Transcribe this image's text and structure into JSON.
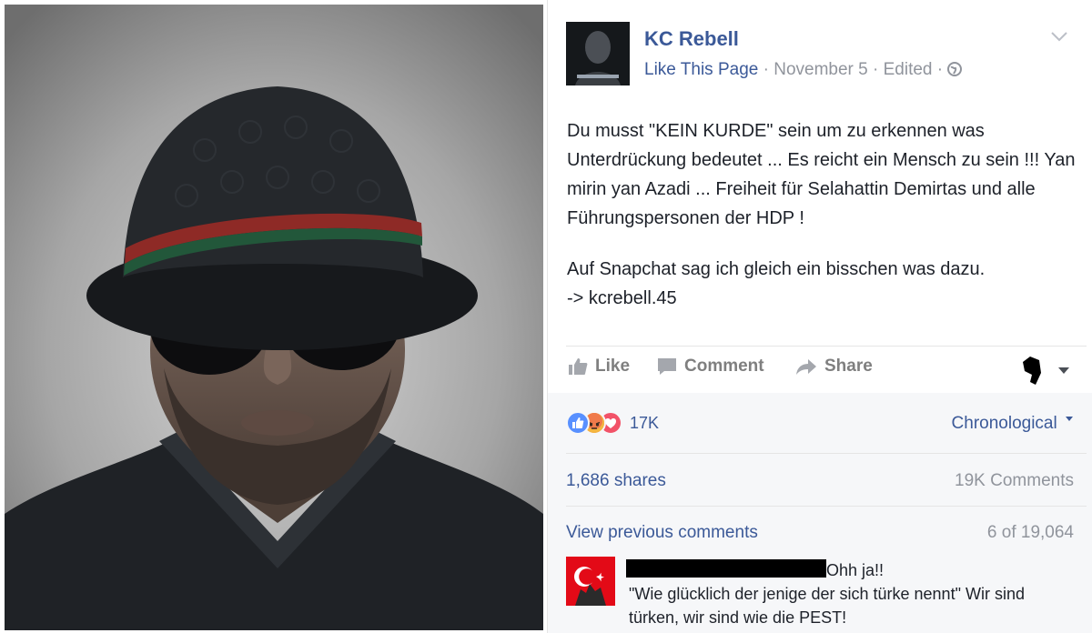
{
  "post": {
    "page_name": "KC Rebell",
    "like_page": "Like This Page",
    "date": "November 5",
    "edited": "Edited",
    "separator": " · ",
    "body_1": "Du musst \"KEIN KURDE\" sein um zu erkennen was Unterdrückung bedeutet ... Es reicht ein Mensch zu sein !!! Yan mirin yan Azadi ... Freiheit für Selahattin Demirtas und alle Führungspersonen der HDP !",
    "body_2_line1": "Auf Snapchat sag ich gleich ein bisschen was dazu.",
    "body_2_line2": "-> kcrebell.45"
  },
  "actions": {
    "like": "Like",
    "comment": "Comment",
    "share": "Share"
  },
  "reactions": {
    "count": "17K",
    "sort": "Chronological",
    "types": [
      "like-icon",
      "angry-icon",
      "love-icon"
    ],
    "colors": {
      "like": "#5890ff",
      "angry": "#f7714b",
      "love": "#f25268"
    }
  },
  "stats": {
    "shares": "1,686 shares",
    "comments": "19K Comments"
  },
  "comments": {
    "view_previous": "View previous comments",
    "position": "6 of 19,064",
    "first": {
      "line1": "Ohh ja!!",
      "quote": "\"Wie glücklich der jenige der sich türke nennt\" Wir sind türken, wir sind wie die PEST!"
    }
  },
  "colors": {
    "link": "#3b5998",
    "meta": "#90949c",
    "text": "#1d2129"
  }
}
